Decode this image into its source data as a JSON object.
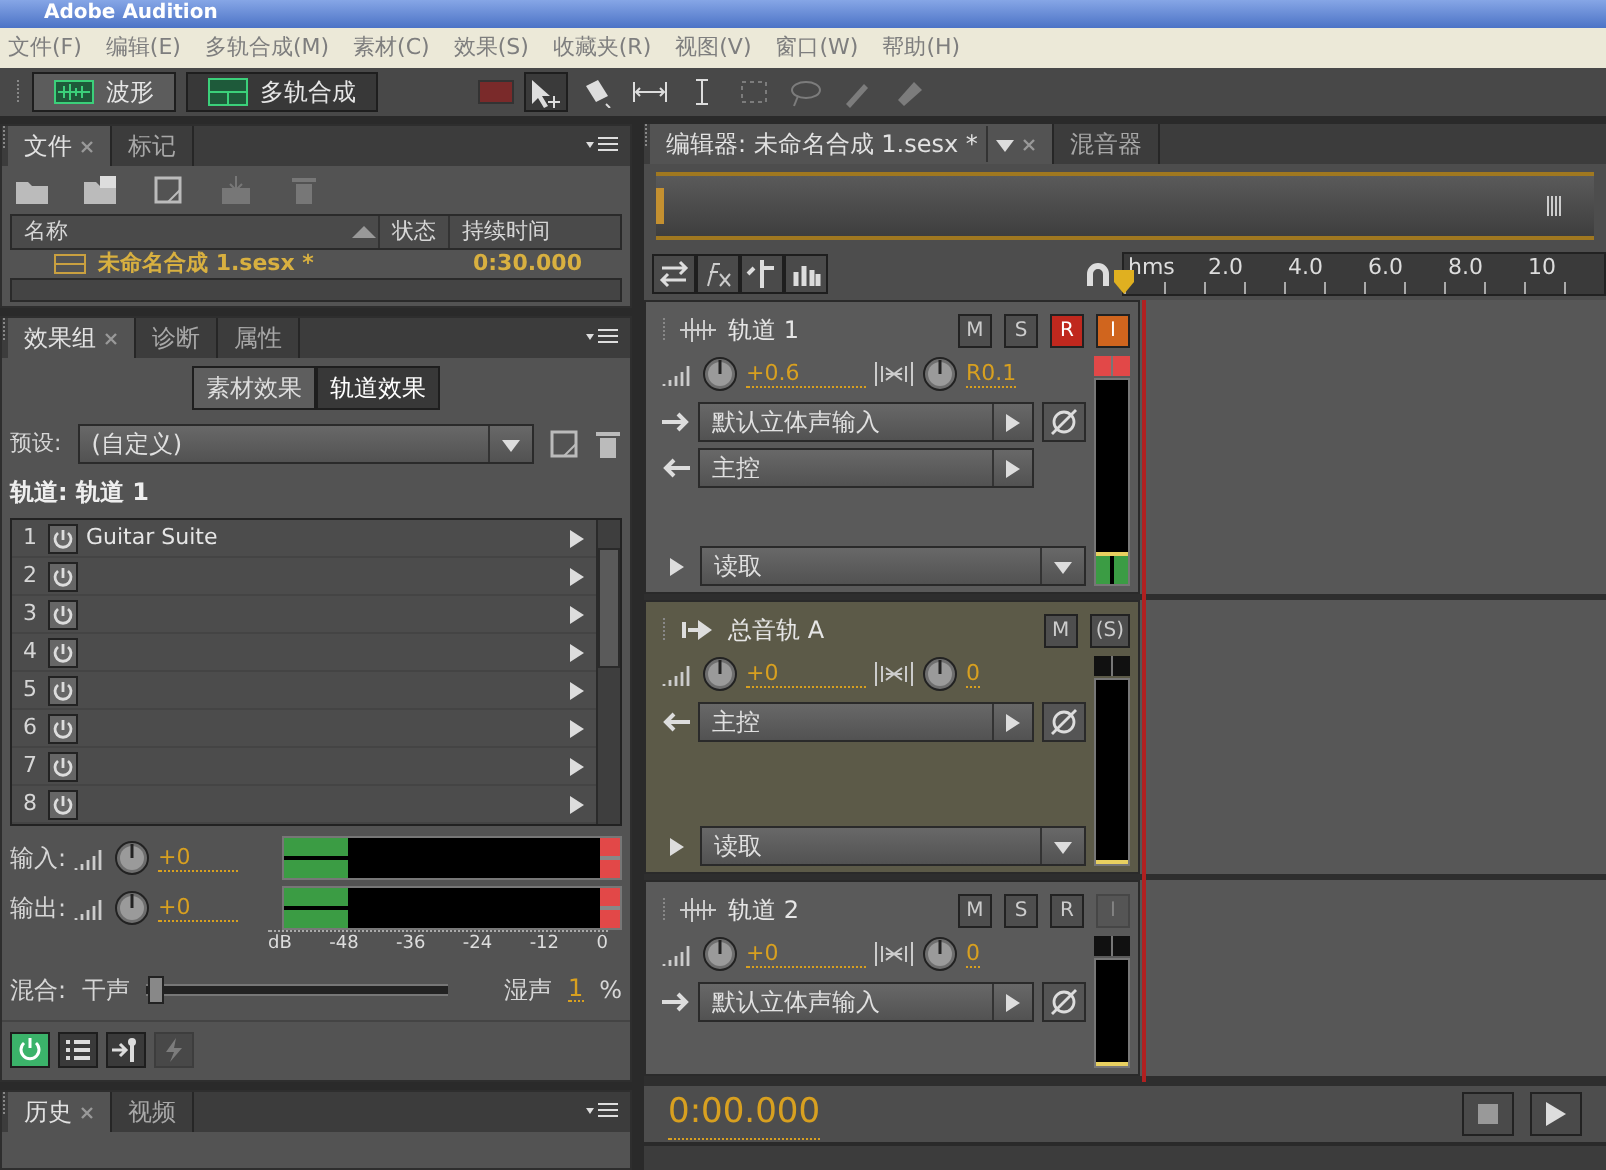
{
  "window": {
    "title": "Adobe Audition"
  },
  "menu": [
    "文件(F)",
    "编辑(E)",
    "多轨合成(M)",
    "素材(C)",
    "效果(S)",
    "收藏夹(R)",
    "视图(V)",
    "窗口(W)",
    "帮助(H)"
  ],
  "workspaces": [
    {
      "label": "波形",
      "selected": false
    },
    {
      "label": "多轨合成",
      "selected": true
    }
  ],
  "tools": [
    {
      "selected": true,
      "disabled": false
    },
    {
      "selected": false,
      "disabled": false
    },
    {
      "selected": false,
      "disabled": false
    },
    {
      "selected": false,
      "disabled": false
    },
    {
      "selected": false,
      "disabled": true
    },
    {
      "selected": false,
      "disabled": true
    },
    {
      "selected": false,
      "disabled": true
    },
    {
      "selected": false,
      "disabled": true
    }
  ],
  "files_panel": {
    "tabs": [
      {
        "label": "文件",
        "selected": true
      },
      {
        "label": "标记",
        "selected": false
      }
    ],
    "tools": [
      {
        "disabled": false
      },
      {
        "disabled": false
      },
      {
        "disabled": false
      },
      {
        "disabled": true
      },
      {
        "disabled": true
      }
    ],
    "columns": [
      "名称",
      "状态",
      "持续时间"
    ],
    "rows": [
      {
        "name": "未命名合成 1.sesx *",
        "duration": "0:30.000"
      }
    ]
  },
  "effects_panel": {
    "tabs": [
      {
        "label": "效果组",
        "selected": true
      },
      {
        "label": "诊断",
        "selected": false
      },
      {
        "label": "属性",
        "selected": false
      }
    ],
    "modes": [
      {
        "label": "素材效果",
        "selected": false
      },
      {
        "label": "轨道效果",
        "selected": true
      }
    ],
    "preset_label": "预设:",
    "preset": "(自定义)",
    "track_label": "轨道: 轨道 1",
    "slots": [
      {
        "index": "1",
        "name": "Guitar Suite"
      },
      {
        "index": "2"
      },
      {
        "index": "3"
      },
      {
        "index": "4"
      },
      {
        "index": "5"
      },
      {
        "index": "6"
      },
      {
        "index": "7"
      },
      {
        "index": "8"
      }
    ],
    "io": [
      {
        "label": "输入:",
        "value": "+0",
        "level": 0.2,
        "clip": true
      },
      {
        "label": "输出:",
        "value": "+0",
        "level": 0.2,
        "clip": true
      }
    ],
    "scale": [
      "dB",
      "-48",
      "-36",
      "-24",
      "-12",
      "0"
    ],
    "mix": {
      "label": "混合:",
      "dry": "干声",
      "wet": "湿声",
      "value": "1",
      "unit": "%",
      "level": 0.01
    },
    "buttons": [
      {
        "selected": true,
        "disabled": false
      },
      {
        "selected": false,
        "disabled": false
      },
      {
        "selected": false,
        "disabled": false
      },
      {
        "selected": false,
        "disabled": true
      }
    ]
  },
  "history_panel": {
    "tabs": [
      {
        "label": "历史",
        "selected": true
      },
      {
        "label": "视频",
        "selected": false
      }
    ]
  },
  "editor": {
    "tabs": [
      {
        "label": "编辑器: 未命名合成 1.sesx *",
        "selected": true
      },
      {
        "label": "混音器",
        "selected": false
      }
    ],
    "ruler": [
      "hms",
      "2.0",
      "4.0",
      "6.0",
      "8.0",
      "10"
    ],
    "tracks": [
      {
        "kind": "audio",
        "name": "轨道 1",
        "buttons": [
          {
            "label": "M",
            "kind": "mute",
            "active": false,
            "disabled": false
          },
          {
            "label": "S",
            "kind": "solo",
            "active": false,
            "disabled": false
          },
          {
            "label": "R",
            "kind": "record",
            "active": true,
            "disabled": false
          },
          {
            "label": "I",
            "kind": "input",
            "active": true,
            "disabled": false
          }
        ],
        "volume": "+0.6",
        "pan": "R0.1",
        "input": "默认立体声输入",
        "output": "主控",
        "automation": "读取",
        "meter": {
          "level": 0.16,
          "clip": true
        }
      },
      {
        "kind": "bus",
        "name": "总音轨 A",
        "buttons": [
          {
            "label": "M",
            "kind": "mute",
            "active": false,
            "disabled": false
          },
          {
            "label": "(S)",
            "kind": "solo",
            "active": false,
            "disabled": false
          }
        ],
        "volume": "+0",
        "pan": "0",
        "output": "主控",
        "automation": "读取",
        "meter": {
          "level": 0,
          "clip": false
        }
      },
      {
        "kind": "audio",
        "name": "轨道 2",
        "buttons": [
          {
            "label": "M",
            "kind": "mute",
            "active": false,
            "disabled": false
          },
          {
            "label": "S",
            "kind": "solo",
            "active": false,
            "disabled": false
          },
          {
            "label": "R",
            "kind": "record",
            "active": false,
            "disabled": false
          },
          {
            "label": "I",
            "kind": "input",
            "active": false,
            "disabled": true
          }
        ],
        "volume": "+0",
        "pan": "0",
        "input": "默认立体声输入",
        "meter": {
          "level": 0,
          "clip": false
        }
      }
    ],
    "time": "0:00.000"
  }
}
